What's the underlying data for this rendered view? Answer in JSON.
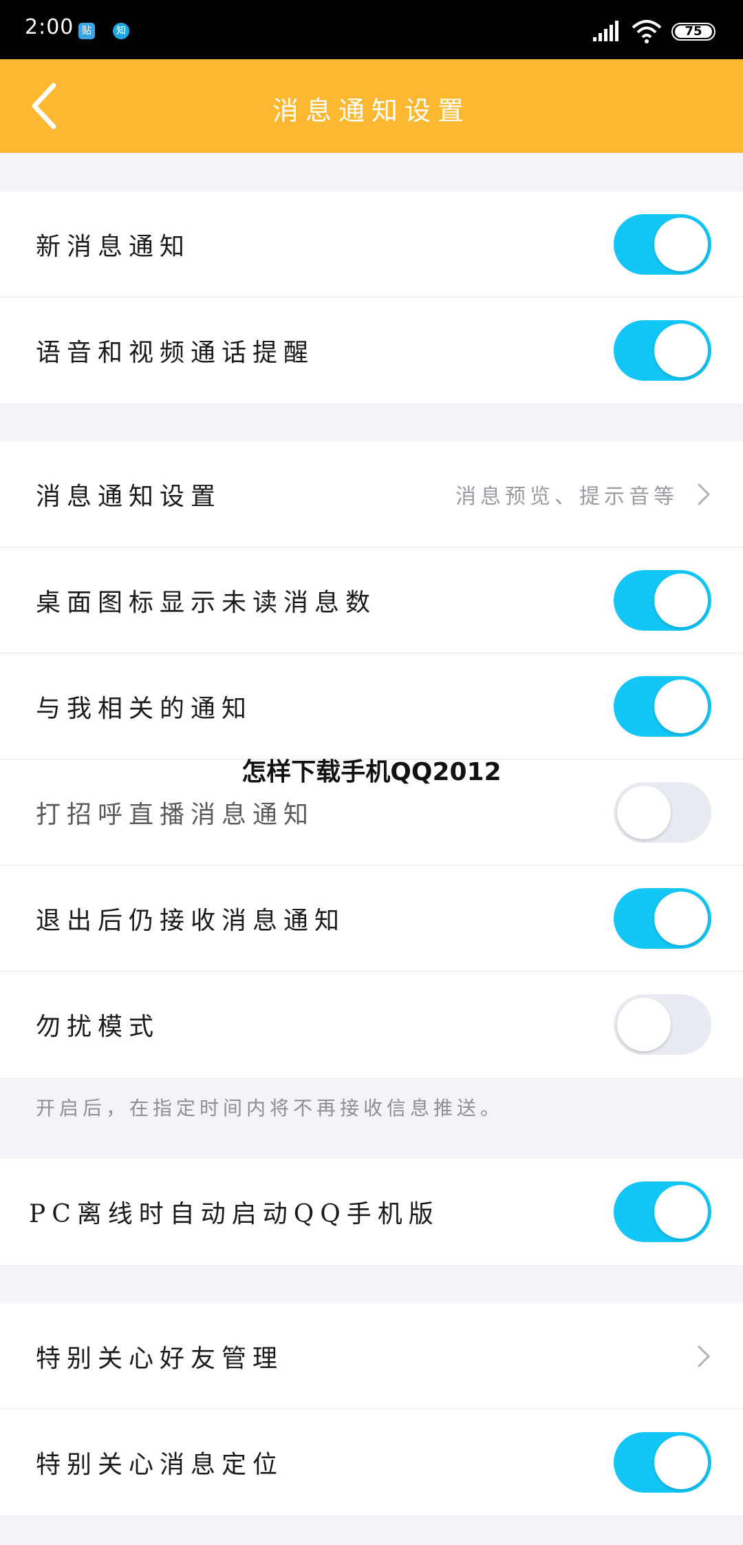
{
  "status_bar": {
    "time": "2:00",
    "app_icons": [
      "贴",
      "知"
    ],
    "battery": "75"
  },
  "nav": {
    "title": "消息通知设置",
    "back_icon": "chevron-left-icon"
  },
  "colors": {
    "nav_background": "#fbb830",
    "toggle_on": "#12c6f8",
    "toggle_off": "#e8ebf2",
    "page_background": "#f3f4f8"
  },
  "group1": {
    "items": [
      {
        "label": "新消息通知",
        "toggle": "on"
      },
      {
        "label": "语音和视频通话提醒",
        "toggle": "on"
      }
    ]
  },
  "group2": {
    "items": [
      {
        "label": "消息通知设置",
        "hint": "消息预览、提示音等"
      },
      {
        "label": "桌面图标显示未读消息数",
        "toggle": "on"
      },
      {
        "label": "与我相关的通知",
        "toggle": "on"
      },
      {
        "label": "打招呼直播消息通知",
        "toggle": "off"
      },
      {
        "label": "退出后仍接收消息通知",
        "toggle": "on"
      },
      {
        "label": "勿扰模式",
        "toggle": "off"
      }
    ]
  },
  "footnote": "开启后，在指定时间内将不再接收信息推送。",
  "group3": {
    "items": [
      {
        "label": "PC离线时自动启动QQ手机版",
        "toggle": "on"
      }
    ]
  },
  "group4": {
    "items": [
      {
        "label": "特别关心好友管理"
      },
      {
        "label": "特别关心消息定位",
        "toggle": "on"
      }
    ]
  },
  "watermark": "怎样下载手机QQ2012"
}
